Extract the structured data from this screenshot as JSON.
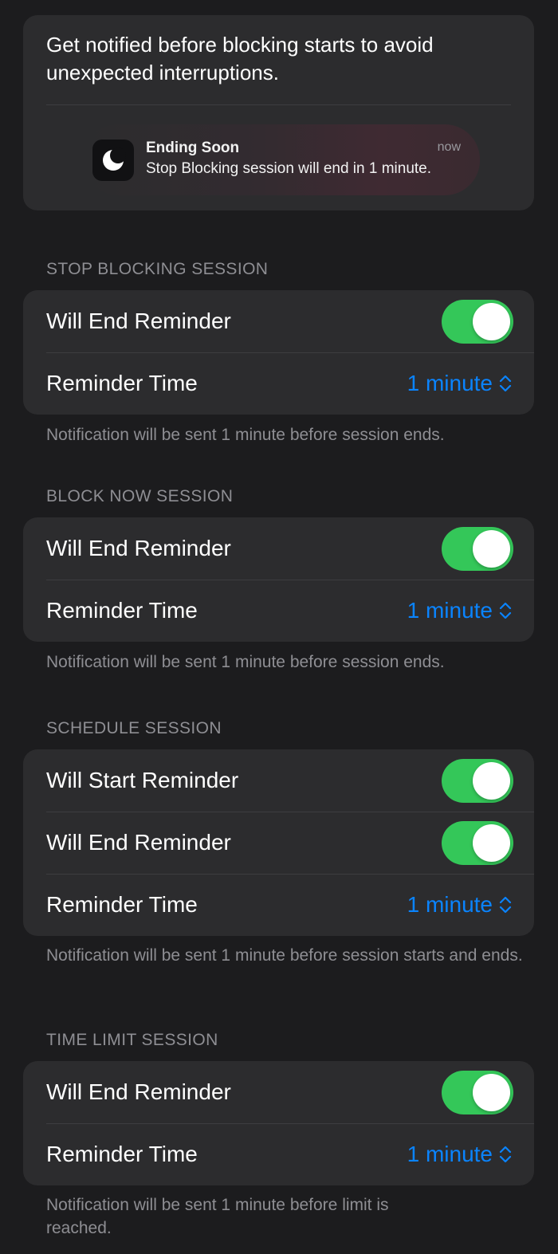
{
  "intro": {
    "text": "Get notified before blocking starts to avoid unexpected interruptions.",
    "preview": {
      "title": "Ending Soon",
      "time": "now",
      "body": "Stop Blocking session will end in 1 minute.",
      "icon": "moon-icon"
    }
  },
  "sections": {
    "stop_blocking": {
      "header": "STOP BLOCKING SESSION",
      "will_end_label": "Will End Reminder",
      "will_end_on": true,
      "reminder_time_label": "Reminder Time",
      "reminder_time_value": "1 minute",
      "footer": "Notification will be sent 1 minute before session ends."
    },
    "block_now": {
      "header": "BLOCK NOW SESSION",
      "will_end_label": "Will End Reminder",
      "will_end_on": true,
      "reminder_time_label": "Reminder Time",
      "reminder_time_value": "1 minute",
      "footer": "Notification will be sent 1 minute before session ends."
    },
    "schedule": {
      "header": "SCHEDULE SESSION",
      "will_start_label": "Will Start Reminder",
      "will_start_on": true,
      "will_end_label": "Will End Reminder",
      "will_end_on": true,
      "reminder_time_label": "Reminder Time",
      "reminder_time_value": "1 minute",
      "footer": "Notification will be sent 1 minute before session starts and ends."
    },
    "time_limit": {
      "header": "TIME LIMIT SESSION",
      "will_end_label": "Will End Reminder",
      "will_end_on": true,
      "reminder_time_label": "Reminder Time",
      "reminder_time_value": "1 minute",
      "footer": "Notification will be sent 1 minute before limit is reached."
    }
  },
  "colors": {
    "background": "#1c1c1e",
    "card": "#2c2c2e",
    "toggle_on": "#34c759",
    "accent": "#0a84ff",
    "secondary_text": "#8e8e93"
  }
}
